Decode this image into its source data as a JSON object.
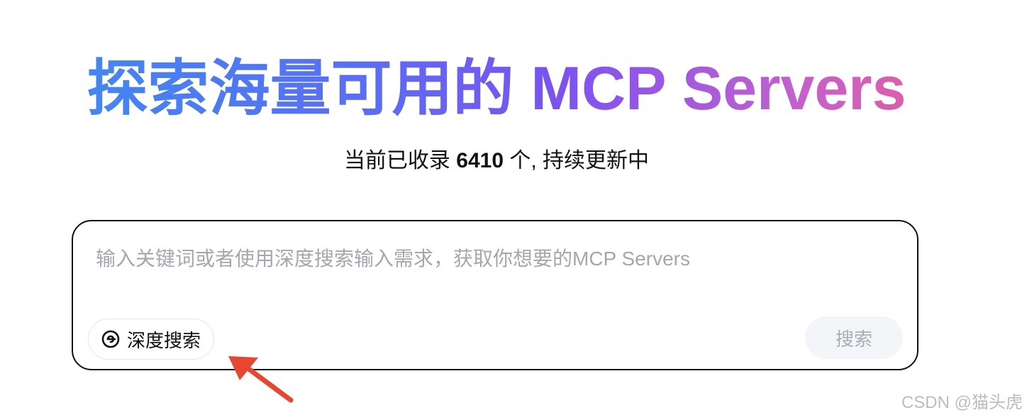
{
  "hero": {
    "title": "探索海量可用的 MCP Servers"
  },
  "subtitle": {
    "prefix": "当前已收录 ",
    "count": "6410",
    "suffix": " 个, 持续更新中"
  },
  "search": {
    "placeholder": "输入关键词或者使用深度搜索输入需求，获取你想要的MCP Servers",
    "value": "",
    "deep_search_label": "深度搜索",
    "submit_label": "搜索"
  },
  "annotation": {
    "arrow_color": "#e8462f"
  },
  "watermark": {
    "text": "CSDN @猫头虎"
  },
  "colors": {
    "gradient_start": "#3a8ef2",
    "gradient_mid": "#7b52f3",
    "gradient_end": "#ef5e8e",
    "border": "#111111",
    "submit_bg": "#f4f5f8"
  },
  "icons": {
    "deep_search": "deep-search-icon"
  }
}
